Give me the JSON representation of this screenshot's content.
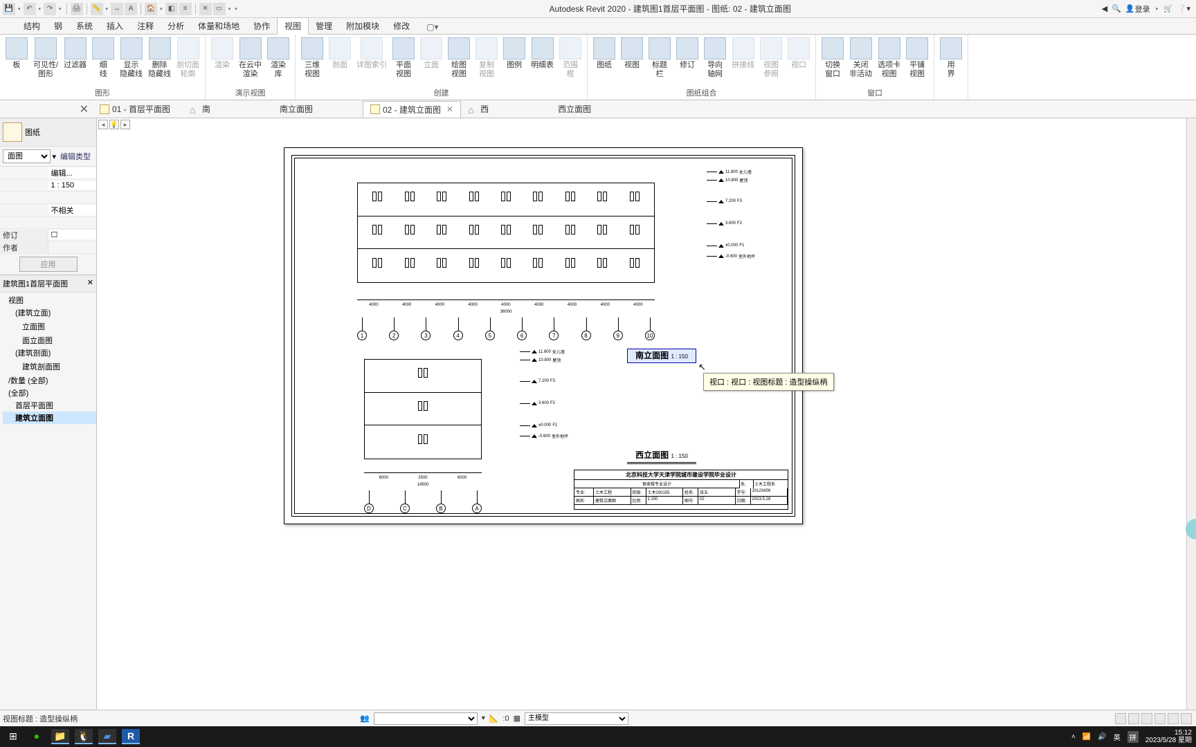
{
  "titlebar": {
    "doc_title": "Autodesk Revit 2020 - 建筑图1首层平面图 - 图纸: 02 - 建筑立面图",
    "login": "登录"
  },
  "menu": {
    "tabs": [
      "",
      "结构",
      "钢",
      "系统",
      "插入",
      "注释",
      "分析",
      "体量和场地",
      "协作",
      "视图",
      "管理",
      "附加模块",
      "修改"
    ],
    "active": "视图"
  },
  "ribbon": {
    "g1": {
      "b1": "板",
      "b2": "可见性/\n图形",
      "b3": "过滤器",
      "b4": "细\n线",
      "b5": "显示\n隐藏线",
      "b6": "删除\n隐藏线",
      "b7": "剖切面\n轮廓",
      "label": "图形"
    },
    "g2": {
      "b1": "渲染",
      "b2": "在云中\n渲染",
      "b3": "渲染\n库",
      "label": "演示视图"
    },
    "g3": {
      "b1": "三维\n视图",
      "b2": "剖面",
      "b3": "详图索引",
      "b4": "平面\n视图",
      "b5": "立面",
      "b6": "绘图\n视图",
      "b7": "复制\n视图",
      "b8": "图例",
      "b9": "明细表",
      "b10": "范围\n框",
      "label": "创建"
    },
    "g4": {
      "b1": "图纸",
      "b2": "视图",
      "b3": "标题\n栏",
      "b4": "修订",
      "b5": "导向\n轴网",
      "b6": "拼接线",
      "b7": "视图\n参照",
      "b8": "视口",
      "label": "图纸组合"
    },
    "g5": {
      "b1": "切换\n窗口",
      "b2": "关闭\n非活动",
      "b3": "选项卡\n视图",
      "b4": "平铺\n视图",
      "label": "窗口"
    },
    "g6": {
      "b1": "用\n界"
    }
  },
  "doctabs": {
    "t1": "01 - 首层平面图",
    "t2": "南",
    "t3": "南立面图",
    "t4": "02 - 建筑立面图",
    "t5": "西",
    "t6": "西立面图"
  },
  "props": {
    "header": "图纸",
    "type_dd": "面图",
    "edit_type": "编辑类型",
    "rows": [
      {
        "l": "",
        "v": "编辑..."
      },
      {
        "l": "",
        "v": "1 : 150"
      },
      {
        "l": "",
        "v": ""
      },
      {
        "l": "",
        "v": "不相关"
      },
      {
        "l": "",
        "v": ""
      },
      {
        "l": "修订",
        "v": "☐"
      },
      {
        "l": "作者",
        "v": ""
      }
    ],
    "apply": "应用"
  },
  "browser": {
    "title": "建筑图1首层平面图",
    "items": [
      {
        "t": "视图",
        "lv": 1
      },
      {
        "t": "(建筑立面)",
        "lv": 2
      },
      {
        "t": "",
        "lv": 3
      },
      {
        "t": "立面图",
        "lv": 3
      },
      {
        "t": "",
        "lv": 3
      },
      {
        "t": "面立面图",
        "lv": 3
      },
      {
        "t": "(建筑剖面)",
        "lv": 2
      },
      {
        "t": "",
        "lv": 3
      },
      {
        "t": "建筑剖面图",
        "lv": 3
      },
      {
        "t": "",
        "lv": 1
      },
      {
        "t": "/数量 (全部)",
        "lv": 1
      },
      {
        "t": "(全部)",
        "lv": 1
      },
      {
        "t": "首层平面图",
        "lv": 2
      },
      {
        "t": "建筑立面图",
        "lv": 2,
        "sel": true
      }
    ]
  },
  "canvas": {
    "south_title": "南立面图",
    "south_scale": "1 : 150",
    "west_title": "西立面图",
    "west_scale": "1 : 150",
    "tooltip": "视口 : 视口 : 视图标题 : 造型操纵柄",
    "grids_top": [
      "1",
      "2",
      "3",
      "4",
      "5",
      "6",
      "7",
      "8",
      "9",
      "10"
    ],
    "grids_bot": [
      "D",
      "C",
      "B",
      "A"
    ],
    "levels": [
      {
        "e": "11.800",
        "n": "女儿墙"
      },
      {
        "e": "10.800",
        "n": "屋顶"
      },
      {
        "e": "7.200",
        "n": "F3"
      },
      {
        "e": "3.600",
        "n": "F2"
      },
      {
        "e": "±0.000",
        "n": "F1"
      },
      {
        "e": "-0.600",
        "n": "室外地坪"
      }
    ],
    "dim_span": "36000",
    "dim_bay": "4000",
    "dim_span2": "14500",
    "dim_bay2a": "6000",
    "dim_bay2b": "2500"
  },
  "titleblock": {
    "head": "北京科技大学天津学院城市建设学院毕业设计",
    "sub": "宿舍楼专业设计",
    "r1": {
      "a": "专业:",
      "b": "土木工程",
      "c": "班级:",
      "d": "土木200155",
      "e": "姓名:",
      "f": "张五",
      "g": "学号:",
      "h": "20123456"
    },
    "r2": {
      "a": "图名:",
      "b": "建筑立面图",
      "c": "比例:",
      "d": "1:150",
      "e": "图号:",
      "f": "02",
      "g": "日期:",
      "h": "2023.5.28"
    },
    "dept_l": "系:",
    "dept_v": "土木工程系"
  },
  "status": {
    "text": "视图标题 : 造型操纵柄",
    "scale_input": ":0",
    "model_dd": "主模型"
  },
  "taskbar": {
    "time": "15:12",
    "date": "2023/5/28 星期",
    "ime": "英",
    "ime2": "拼"
  }
}
